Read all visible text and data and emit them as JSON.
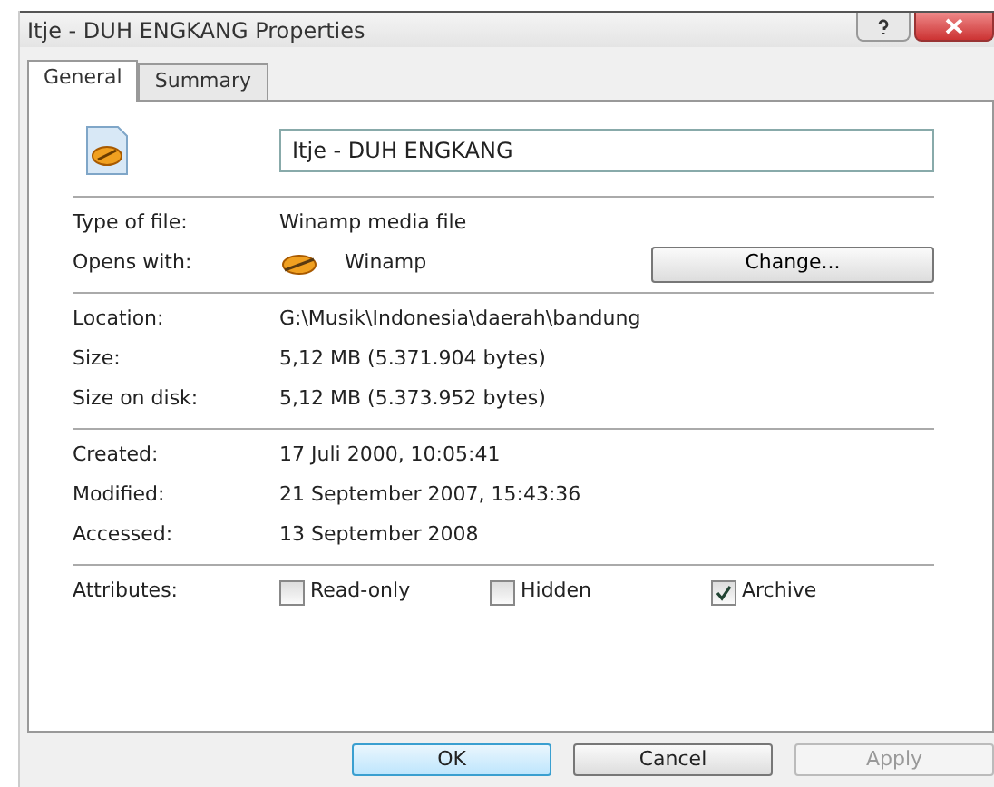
{
  "window": {
    "title": "Itje - DUH ENGKANG Properties"
  },
  "tabs": [
    {
      "label": "General",
      "selected": true
    },
    {
      "label": "Summary",
      "selected": false
    }
  ],
  "file_name": "Itje - DUH ENGKANG",
  "sections": [
    [
      {
        "label": "Type of file:",
        "value": "Winamp media file"
      },
      {
        "label": "Opens with:",
        "value": "Winamp",
        "kind": "app",
        "button": "Change..."
      }
    ],
    [
      {
        "label": "Location:",
        "value": "G:\\Musik\\Indonesia\\daerah\\bandung"
      },
      {
        "label": "Size:",
        "value": "5,12 MB (5.371.904 bytes)"
      },
      {
        "label": "Size on disk:",
        "value": "5,12 MB (5.373.952 bytes)"
      }
    ],
    [
      {
        "label": "Created:",
        "value": "17 Juli 2000, 10:05:41"
      },
      {
        "label": "Modified:",
        "value": "21 September 2007, 15:43:36"
      },
      {
        "label": "Accessed:",
        "value": "13 September 2008"
      }
    ]
  ],
  "attributes": {
    "label": "Attributes:",
    "items": [
      {
        "label": "Read-only",
        "checked": false
      },
      {
        "label": "Hidden",
        "checked": false
      },
      {
        "label": "Archive",
        "checked": true
      }
    ]
  },
  "buttons": [
    {
      "label": "OK",
      "disabled": false,
      "default": true
    },
    {
      "label": "Cancel",
      "disabled": false,
      "default": false
    },
    {
      "label": "Apply",
      "disabled": true,
      "default": false
    }
  ]
}
